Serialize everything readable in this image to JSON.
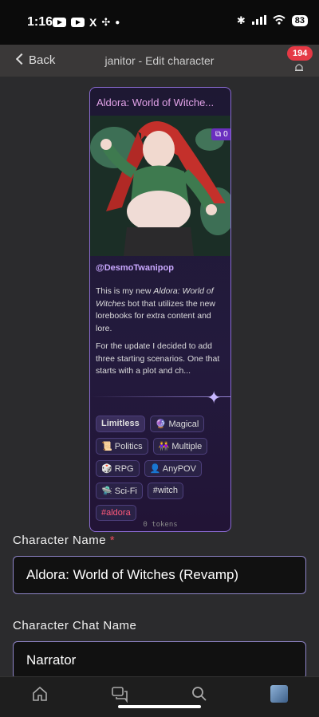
{
  "status": {
    "time": "1:16",
    "battery": "83"
  },
  "header": {
    "back_label": "Back",
    "title": "janitor - Edit character",
    "notification_count": "194"
  },
  "card": {
    "title": "Aldora: World of Witche...",
    "image_count": "0",
    "author": "@DesmoTwanipop",
    "description_p1_a": "This is my new ",
    "description_p1_italic": "Aldora: World of Witches",
    "description_p1_b": " bot that utilizes the new lorebooks for extra content and lore.",
    "description_p2": "For the update I decided to add three starting scenarios. One that starts with a plot and ch...",
    "tags": [
      {
        "label": "Limitless"
      },
      {
        "label": "🔮 Magical"
      },
      {
        "label": "📜 Politics"
      },
      {
        "label": "👭 Multiple"
      },
      {
        "label": "🎲 RPG"
      },
      {
        "label": "👤 AnyPOV"
      },
      {
        "label": "🛸 Sci-Fi"
      },
      {
        "label": "#witch"
      },
      {
        "label": "#aldora"
      }
    ],
    "tokens": "0 tokens"
  },
  "form": {
    "character_name_label": "Character Name",
    "required_mark": "*",
    "character_name_value": "Aldora: World of Witches (Revamp)",
    "chat_name_label": "Character Chat Name",
    "chat_name_value": "Narrator"
  },
  "tabbar": {
    "items": [
      "home-icon",
      "chat-icon",
      "search-icon",
      "profile-avatar"
    ]
  },
  "colors": {
    "accent": "#8f85c8",
    "badge": "#e53945",
    "title": "#e1a2e8"
  }
}
